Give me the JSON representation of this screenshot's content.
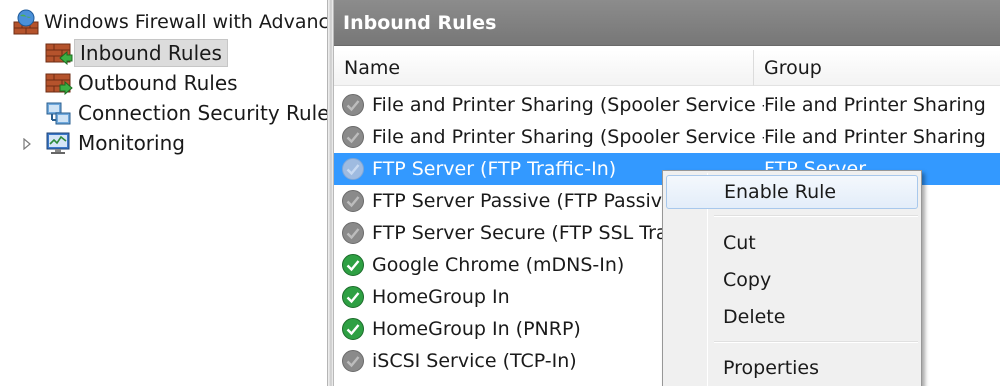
{
  "tree": {
    "root_label": "Windows Firewall with Advance",
    "items": [
      {
        "label": "Inbound Rules",
        "icon": "inbound-rules-icon",
        "selected": true
      },
      {
        "label": "Outbound Rules",
        "icon": "outbound-rules-icon",
        "selected": false
      },
      {
        "label": "Connection Security Rules",
        "icon": "connection-security-icon",
        "selected": false
      },
      {
        "label": "Monitoring",
        "icon": "monitoring-icon",
        "selected": false
      }
    ]
  },
  "pane": {
    "title": "Inbound Rules",
    "columns": {
      "name": "Name",
      "group": "Group"
    }
  },
  "rules": [
    {
      "name": "File and Printer Sharing (Spooler Service -...",
      "group": "File and Printer Sharing",
      "status": "disabled"
    },
    {
      "name": "File and Printer Sharing (Spooler Service -...",
      "group": "File and Printer Sharing",
      "status": "disabled"
    },
    {
      "name": "FTP Server (FTP Traffic-In)",
      "group": "FTP Server",
      "status": "disabled",
      "selected": true
    },
    {
      "name": "FTP Server Passive (FTP Passive T",
      "group": "",
      "status": "disabled"
    },
    {
      "name": "FTP Server Secure (FTP SSL Traffic",
      "group": "",
      "status": "disabled"
    },
    {
      "name": "Google Chrome (mDNS-In)",
      "group": "",
      "status": "enabled"
    },
    {
      "name": "HomeGroup In",
      "group": "",
      "status": "enabled"
    },
    {
      "name": "HomeGroup In (PNRP)",
      "group": "",
      "status": "enabled"
    },
    {
      "name": "iSCSI Service (TCP-In)",
      "group": "",
      "status": "disabled"
    }
  ],
  "context_menu": {
    "enable_rule": "Enable Rule",
    "cut": "Cut",
    "copy": "Copy",
    "delete": "Delete",
    "properties": "Properties"
  },
  "colors": {
    "selection": "#3399ff",
    "header": "#808080",
    "enabled": "#2ea043",
    "disabled": "#8a8a8a"
  }
}
